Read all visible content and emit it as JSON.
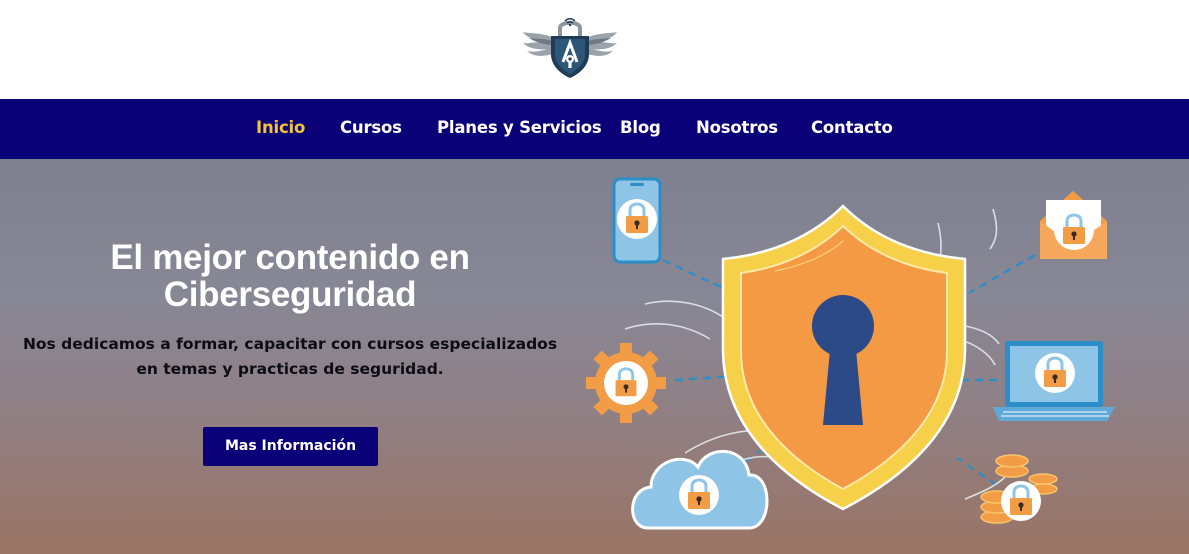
{
  "header": {
    "logo_icon": "winged-shield-lock-logo"
  },
  "nav": {
    "items": [
      {
        "label": "Inicio",
        "active": true
      },
      {
        "label": "Cursos",
        "active": false
      },
      {
        "label": "Planes y Servicios",
        "active": false
      },
      {
        "label": "Blog",
        "active": false
      },
      {
        "label": "Nosotros",
        "active": false
      },
      {
        "label": "Contacto",
        "active": false
      }
    ]
  },
  "hero": {
    "title": "El mejor contenido en Ciberseguridad",
    "subtitle_line1": "Nos dedicamos a formar, capacitar con cursos especializados",
    "subtitle_line2": "en temas y practicas de seguridad.",
    "cta_label": "Mas Información",
    "illustration_icons": [
      "shield-keyhole-icon",
      "smartphone-lock-icon",
      "gear-lock-icon",
      "cloud-lock-icon",
      "envelope-lock-icon",
      "laptop-lock-icon",
      "coins-lock-icon"
    ]
  },
  "colors": {
    "nav_bg": "#0a0178",
    "active_nav": "#f5c432",
    "button_bg": "#0a0178",
    "shield_outer": "#f7d04a",
    "shield_inner": "#f49a44",
    "keyhole": "#2b4a87",
    "lock_orange": "#f29c46",
    "lock_blue": "#93c7e8"
  }
}
